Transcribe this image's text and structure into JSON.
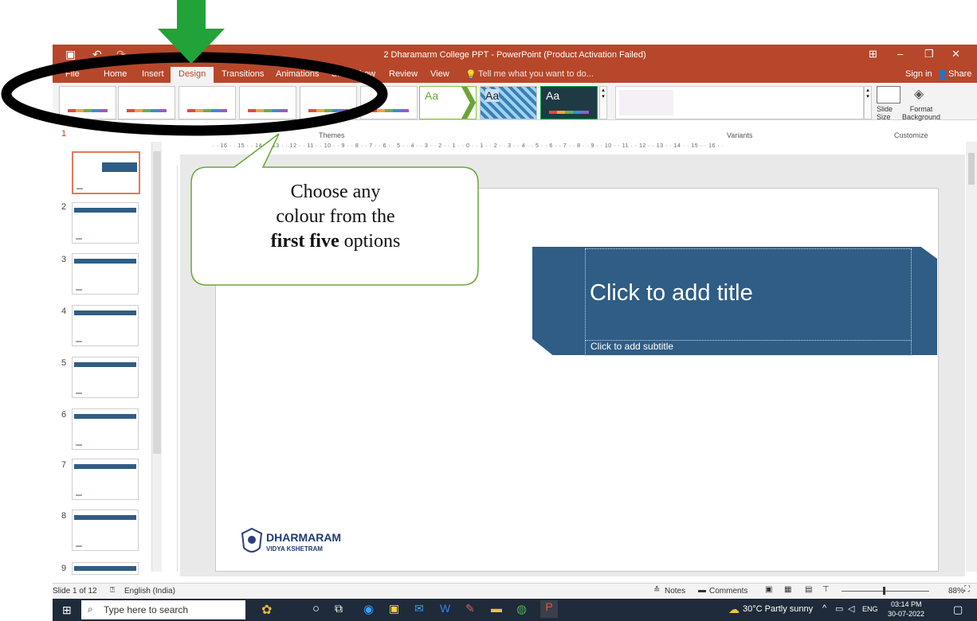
{
  "window": {
    "title": "2 Dharamarm College PPT - PowerPoint (Product Activation Failed)",
    "sign_in": "Sign in",
    "share": "Share"
  },
  "tabs": [
    "File",
    "Home",
    "Insert",
    "Design",
    "Transitions",
    "Animations",
    "Slide Show",
    "Review",
    "View"
  ],
  "active_tab": "Design",
  "tell_me": "Tell me what you want to do...",
  "ribbon": {
    "themes_label": "Themes",
    "variants_label": "Variants",
    "customize_label": "Customize",
    "slide_size": "Slide\nSize",
    "format_background": "Format\nBackground",
    "theme_samples": [
      "Aa",
      "Aa",
      "Aa"
    ]
  },
  "ruler_text": "· · 16 · · 15 · · 14 · · 13 · · 12 · · 11 · · 10 · · 9 · · 8 · · 7 · · 6 · · 5 · · 4 · · 3 · · 2 · · 1 · · 0 · · 1 · · 2 · · 3 · · 4 · · 5 · · 6 · · 7 · · 8 · · 9 · · 10 · · 11 · · 12 · · 13 · · 14 · · 15 · · 16 · ·",
  "thumbnails": [
    "1",
    "2",
    "3",
    "4",
    "5",
    "6",
    "7",
    "8",
    "9"
  ],
  "callout": {
    "line1": "Choose any",
    "line2": "colour from the",
    "bold": "first five",
    "line3_rest": " options"
  },
  "slide": {
    "title_placeholder": "Click to add title",
    "subtitle_placeholder": "Click to add subtitle",
    "logo_name": "DHARMARAM",
    "logo_sub": "VIDYA KSHETRAM"
  },
  "status": {
    "slide_of": "Slide 1 of 12",
    "language": "English (India)",
    "notes": "Notes",
    "comments": "Comments",
    "zoom": "88%"
  },
  "taskbar": {
    "search_placeholder": "Type here to search",
    "weather": "30°C  Partly sunny",
    "lang": "ENG",
    "time": "03:14 PM",
    "date": "30-07-2022"
  },
  "colors": {
    "titlebar": "#b7472a",
    "title_box": "#2f5d85",
    "callout_border": "#6aa536",
    "arrow": "#22a33a"
  }
}
